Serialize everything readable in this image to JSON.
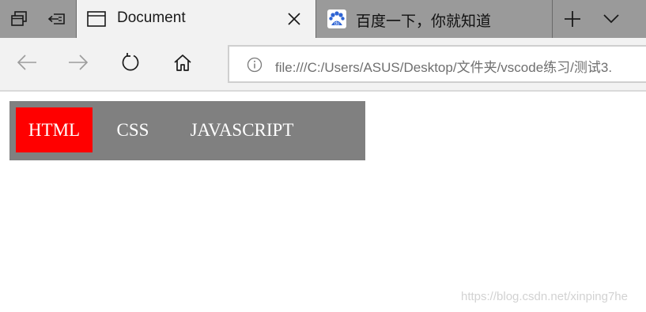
{
  "tabs": [
    {
      "title": "Document",
      "active": true,
      "icon": "page-icon"
    },
    {
      "title": "百度一下，你就知道",
      "active": false,
      "icon": "baidu-paw-icon"
    }
  ],
  "strip_icons": [
    "tab-preview-icon",
    "set-aside-tabs-icon",
    "new-tab-plus-icon",
    "tab-list-chevron-icon"
  ],
  "nav": {
    "icons": [
      "back-arrow-icon",
      "forward-arrow-icon",
      "refresh-icon",
      "home-icon"
    ],
    "address_url": "file:///C:/Users/ASUS/Desktop/文件夹/vscode练习/测试3."
  },
  "page": {
    "menu_items": [
      {
        "label": "HTML",
        "active": true
      },
      {
        "label": "CSS",
        "active": false
      },
      {
        "label": "JAVASCRIPT",
        "active": false
      }
    ],
    "menu_colors": {
      "bar": "#808080",
      "active": "#ff0000",
      "text": "#ffffff"
    },
    "watermark": "https://blog.csdn.net/xinping7he"
  }
}
